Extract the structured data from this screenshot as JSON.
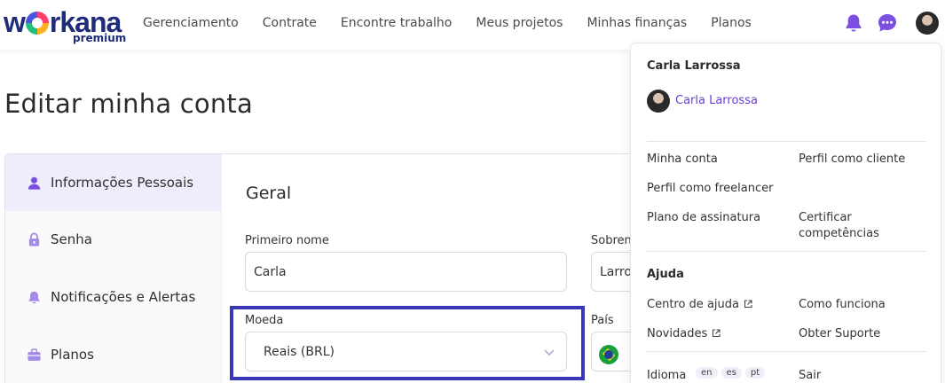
{
  "brand": {
    "word_left": "w",
    "word_right": "rkana",
    "sub": "premium"
  },
  "nav": [
    "Gerenciamento",
    "Contrate",
    "Encontre trabalho",
    "Meus projetos",
    "Minhas finanças",
    "Planos"
  ],
  "icons": {
    "bell": "bell-icon",
    "chat": "chat-icon",
    "accent": "#7b4fe0"
  },
  "page": {
    "title": "Editar minha conta"
  },
  "sidebar": {
    "items": [
      {
        "label": "Informações Pessoais",
        "icon": "user-icon"
      },
      {
        "label": "Senha",
        "icon": "lock-icon"
      },
      {
        "label": "Notificações e Alertas",
        "icon": "bell-icon"
      },
      {
        "label": "Planos",
        "icon": "briefcase-icon"
      }
    ]
  },
  "form": {
    "section_title": "Geral",
    "first_name_label": "Primeiro nome",
    "first_name_value": "Carla",
    "last_name_label": "Sobrenome",
    "last_name_value": "Larrossa",
    "currency_label": "Moeda",
    "currency_value": "Reais (BRL)",
    "country_label": "País"
  },
  "menu": {
    "user_name": "Carla Larrossa",
    "profile_link": "Carla Larrossa",
    "links": {
      "my_account": "Minha conta",
      "client_profile": "Perfil como cliente",
      "freelancer_profile": "Perfil como freelancer",
      "subscription": "Plano de assinatura",
      "certify_line1": "Certificar",
      "certify_line2": "competências"
    },
    "help_heading": "Ajuda",
    "help_links": {
      "help_center": "Centro de ajuda",
      "how_it_works": "Como funciona",
      "news": "Novidades",
      "support": "Obter Suporte"
    },
    "language_label": "Idioma",
    "languages": [
      "en",
      "es",
      "pt"
    ],
    "logout": "Sair"
  }
}
